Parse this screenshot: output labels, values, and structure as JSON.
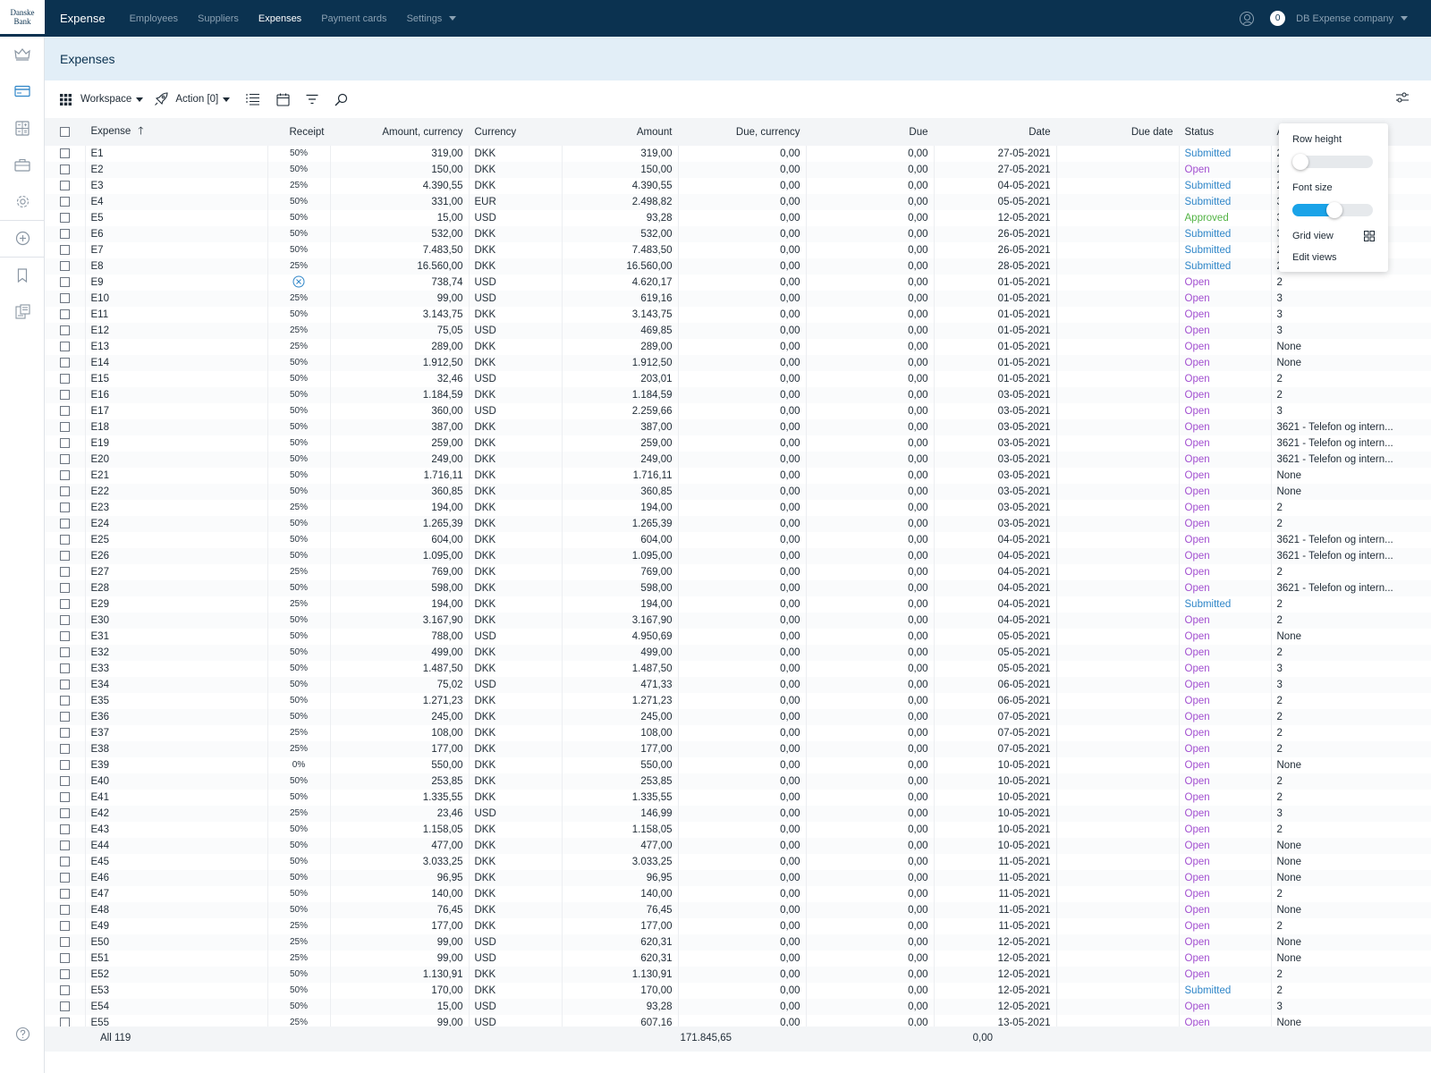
{
  "logo": {
    "line1": "Danske",
    "line2": "Bank"
  },
  "app_title": "Expense",
  "nav": [
    {
      "label": "Employees",
      "active": false
    },
    {
      "label": "Suppliers",
      "active": false
    },
    {
      "label": "Expenses",
      "active": true
    },
    {
      "label": "Payment cards",
      "active": false
    },
    {
      "label": "Settings",
      "active": false
    }
  ],
  "notifications": "0",
  "company": "DB Expense company",
  "page_title": "Expenses",
  "toolbar": {
    "workspace": "Workspace",
    "action": "Action [0]"
  },
  "columns": [
    "Expense",
    "Receipt",
    "Amount, currency",
    "Currency",
    "Amount",
    "Due, currency",
    "Due",
    "Date",
    "Due date",
    "Status",
    "Ac"
  ],
  "rows": [
    [
      "E1",
      "50%",
      "319,00",
      "DKK",
      "319,00",
      "0,00",
      "0,00",
      "27-05-2021",
      "",
      "Submitted",
      "2"
    ],
    [
      "E2",
      "50%",
      "150,00",
      "DKK",
      "150,00",
      "0,00",
      "0,00",
      "27-05-2021",
      "",
      "Open",
      "2"
    ],
    [
      "E3",
      "25%",
      "4.390,55",
      "DKK",
      "4.390,55",
      "0,00",
      "0,00",
      "04-05-2021",
      "",
      "Submitted",
      "2"
    ],
    [
      "E4",
      "50%",
      "331,00",
      "EUR",
      "2.498,82",
      "0,00",
      "0,00",
      "05-05-2021",
      "",
      "Submitted",
      "3"
    ],
    [
      "E5",
      "50%",
      "15,00",
      "USD",
      "93,28",
      "0,00",
      "0,00",
      "12-05-2021",
      "",
      "Approved",
      "3"
    ],
    [
      "E6",
      "50%",
      "532,00",
      "DKK",
      "532,00",
      "0,00",
      "0,00",
      "26-05-2021",
      "",
      "Submitted",
      "3"
    ],
    [
      "E7",
      "50%",
      "7.483,50",
      "DKK",
      "7.483,50",
      "0,00",
      "0,00",
      "26-05-2021",
      "",
      "Submitted",
      "2"
    ],
    [
      "E8",
      "25%",
      "16.560,00",
      "DKK",
      "16.560,00",
      "0,00",
      "0,00",
      "28-05-2021",
      "",
      "Submitted",
      "2"
    ],
    [
      "E9",
      "",
      "738,74",
      "USD",
      "4.620,17",
      "0,00",
      "0,00",
      "01-05-2021",
      "",
      "Open",
      "2"
    ],
    [
      "E10",
      "25%",
      "99,00",
      "USD",
      "619,16",
      "0,00",
      "0,00",
      "01-05-2021",
      "",
      "Open",
      "3"
    ],
    [
      "E11",
      "50%",
      "3.143,75",
      "DKK",
      "3.143,75",
      "0,00",
      "0,00",
      "01-05-2021",
      "",
      "Open",
      "3"
    ],
    [
      "E12",
      "25%",
      "75,05",
      "USD",
      "469,85",
      "0,00",
      "0,00",
      "01-05-2021",
      "",
      "Open",
      "3"
    ],
    [
      "E13",
      "25%",
      "289,00",
      "DKK",
      "289,00",
      "0,00",
      "0,00",
      "01-05-2021",
      "",
      "Open",
      "None"
    ],
    [
      "E14",
      "50%",
      "1.912,50",
      "DKK",
      "1.912,50",
      "0,00",
      "0,00",
      "01-05-2021",
      "",
      "Open",
      "None"
    ],
    [
      "E15",
      "50%",
      "32,46",
      "USD",
      "203,01",
      "0,00",
      "0,00",
      "01-05-2021",
      "",
      "Open",
      "2"
    ],
    [
      "E16",
      "50%",
      "1.184,59",
      "DKK",
      "1.184,59",
      "0,00",
      "0,00",
      "03-05-2021",
      "",
      "Open",
      "2"
    ],
    [
      "E17",
      "50%",
      "360,00",
      "USD",
      "2.259,66",
      "0,00",
      "0,00",
      "03-05-2021",
      "",
      "Open",
      "3"
    ],
    [
      "E18",
      "50%",
      "387,00",
      "DKK",
      "387,00",
      "0,00",
      "0,00",
      "03-05-2021",
      "",
      "Open",
      "3621 - Telefon og intern..."
    ],
    [
      "E19",
      "50%",
      "259,00",
      "DKK",
      "259,00",
      "0,00",
      "0,00",
      "03-05-2021",
      "",
      "Open",
      "3621 - Telefon og intern..."
    ],
    [
      "E20",
      "50%",
      "249,00",
      "DKK",
      "249,00",
      "0,00",
      "0,00",
      "03-05-2021",
      "",
      "Open",
      "3621 - Telefon og intern..."
    ],
    [
      "E21",
      "50%",
      "1.716,11",
      "DKK",
      "1.716,11",
      "0,00",
      "0,00",
      "03-05-2021",
      "",
      "Open",
      "None"
    ],
    [
      "E22",
      "50%",
      "360,85",
      "DKK",
      "360,85",
      "0,00",
      "0,00",
      "03-05-2021",
      "",
      "Open",
      "None"
    ],
    [
      "E23",
      "25%",
      "194,00",
      "DKK",
      "194,00",
      "0,00",
      "0,00",
      "03-05-2021",
      "",
      "Open",
      "2"
    ],
    [
      "E24",
      "50%",
      "1.265,39",
      "DKK",
      "1.265,39",
      "0,00",
      "0,00",
      "03-05-2021",
      "",
      "Open",
      "2"
    ],
    [
      "E25",
      "50%",
      "604,00",
      "DKK",
      "604,00",
      "0,00",
      "0,00",
      "04-05-2021",
      "",
      "Open",
      "3621 - Telefon og intern..."
    ],
    [
      "E26",
      "50%",
      "1.095,00",
      "DKK",
      "1.095,00",
      "0,00",
      "0,00",
      "04-05-2021",
      "",
      "Open",
      "3621 - Telefon og intern..."
    ],
    [
      "E27",
      "25%",
      "769,00",
      "DKK",
      "769,00",
      "0,00",
      "0,00",
      "04-05-2021",
      "",
      "Open",
      "2"
    ],
    [
      "E28",
      "50%",
      "598,00",
      "DKK",
      "598,00",
      "0,00",
      "0,00",
      "04-05-2021",
      "",
      "Open",
      "3621 - Telefon og intern..."
    ],
    [
      "E29",
      "25%",
      "194,00",
      "DKK",
      "194,00",
      "0,00",
      "0,00",
      "04-05-2021",
      "",
      "Submitted",
      "2"
    ],
    [
      "E30",
      "50%",
      "3.167,90",
      "DKK",
      "3.167,90",
      "0,00",
      "0,00",
      "04-05-2021",
      "",
      "Open",
      "2"
    ],
    [
      "E31",
      "50%",
      "788,00",
      "USD",
      "4.950,69",
      "0,00",
      "0,00",
      "05-05-2021",
      "",
      "Open",
      "None"
    ],
    [
      "E32",
      "50%",
      "499,00",
      "DKK",
      "499,00",
      "0,00",
      "0,00",
      "05-05-2021",
      "",
      "Open",
      "2"
    ],
    [
      "E33",
      "50%",
      "1.487,50",
      "DKK",
      "1.487,50",
      "0,00",
      "0,00",
      "05-05-2021",
      "",
      "Open",
      "3"
    ],
    [
      "E34",
      "50%",
      "75,02",
      "USD",
      "471,33",
      "0,00",
      "0,00",
      "06-05-2021",
      "",
      "Open",
      "3"
    ],
    [
      "E35",
      "50%",
      "1.271,23",
      "DKK",
      "1.271,23",
      "0,00",
      "0,00",
      "06-05-2021",
      "",
      "Open",
      "2"
    ],
    [
      "E36",
      "50%",
      "245,00",
      "DKK",
      "245,00",
      "0,00",
      "0,00",
      "07-05-2021",
      "",
      "Open",
      "2"
    ],
    [
      "E37",
      "25%",
      "108,00",
      "DKK",
      "108,00",
      "0,00",
      "0,00",
      "07-05-2021",
      "",
      "Open",
      "2"
    ],
    [
      "E38",
      "25%",
      "177,00",
      "DKK",
      "177,00",
      "0,00",
      "0,00",
      "07-05-2021",
      "",
      "Open",
      "2"
    ],
    [
      "E39",
      "0%",
      "550,00",
      "DKK",
      "550,00",
      "0,00",
      "0,00",
      "10-05-2021",
      "",
      "Open",
      "None"
    ],
    [
      "E40",
      "50%",
      "253,85",
      "DKK",
      "253,85",
      "0,00",
      "0,00",
      "10-05-2021",
      "",
      "Open",
      "2"
    ],
    [
      "E41",
      "50%",
      "1.335,55",
      "DKK",
      "1.335,55",
      "0,00",
      "0,00",
      "10-05-2021",
      "",
      "Open",
      "2"
    ],
    [
      "E42",
      "25%",
      "23,46",
      "USD",
      "146,99",
      "0,00",
      "0,00",
      "10-05-2021",
      "",
      "Open",
      "3"
    ],
    [
      "E43",
      "50%",
      "1.158,05",
      "DKK",
      "1.158,05",
      "0,00",
      "0,00",
      "10-05-2021",
      "",
      "Open",
      "2"
    ],
    [
      "E44",
      "50%",
      "477,00",
      "DKK",
      "477,00",
      "0,00",
      "0,00",
      "10-05-2021",
      "",
      "Open",
      "None"
    ],
    [
      "E45",
      "50%",
      "3.033,25",
      "DKK",
      "3.033,25",
      "0,00",
      "0,00",
      "11-05-2021",
      "",
      "Open",
      "None"
    ],
    [
      "E46",
      "50%",
      "96,95",
      "DKK",
      "96,95",
      "0,00",
      "0,00",
      "11-05-2021",
      "",
      "Open",
      "None"
    ],
    [
      "E47",
      "50%",
      "140,00",
      "DKK",
      "140,00",
      "0,00",
      "0,00",
      "11-05-2021",
      "",
      "Open",
      "2"
    ],
    [
      "E48",
      "50%",
      "76,45",
      "DKK",
      "76,45",
      "0,00",
      "0,00",
      "11-05-2021",
      "",
      "Open",
      "None"
    ],
    [
      "E49",
      "25%",
      "177,00",
      "DKK",
      "177,00",
      "0,00",
      "0,00",
      "11-05-2021",
      "",
      "Open",
      "2"
    ],
    [
      "E50",
      "25%",
      "99,00",
      "USD",
      "620,31",
      "0,00",
      "0,00",
      "12-05-2021",
      "",
      "Open",
      "None"
    ],
    [
      "E51",
      "25%",
      "99,00",
      "USD",
      "620,31",
      "0,00",
      "0,00",
      "12-05-2021",
      "",
      "Open",
      "None"
    ],
    [
      "E52",
      "50%",
      "1.130,91",
      "DKK",
      "1.130,91",
      "0,00",
      "0,00",
      "12-05-2021",
      "",
      "Open",
      "2"
    ],
    [
      "E53",
      "50%",
      "170,00",
      "DKK",
      "170,00",
      "0,00",
      "0,00",
      "12-05-2021",
      "",
      "Submitted",
      "2"
    ],
    [
      "E54",
      "50%",
      "15,00",
      "USD",
      "93,28",
      "0,00",
      "0,00",
      "12-05-2021",
      "",
      "Open",
      "3"
    ],
    [
      "E55",
      "25%",
      "99,00",
      "USD",
      "607,16",
      "0,00",
      "0,00",
      "13-05-2021",
      "",
      "Open",
      "None"
    ]
  ],
  "footer": {
    "count": "All 119",
    "amount_total": "171.845,65",
    "due_total": "0,00"
  },
  "popover": {
    "row_height_label": "Row height",
    "row_height_on": false,
    "font_size_label": "Font size",
    "font_size_on": true,
    "grid_view_label": "Grid view",
    "edit_views_label": "Edit views"
  },
  "colors": {
    "topbar": "#0b3250",
    "submitted": "#2f86c8",
    "open": "#a24fd0",
    "approved": "#51b343",
    "toggle_on": "#1aa3e8"
  },
  "icons": [
    "crown-icon",
    "card-icon",
    "calculator-icon",
    "briefcase-icon",
    "gear-icon",
    "plus-circle-icon",
    "bookmark-icon",
    "report-icon",
    "help-icon",
    "grid-icon",
    "rocket-icon",
    "list-icon",
    "calendar-icon",
    "filter-icon",
    "search-icon",
    "sliders-icon",
    "no-receipt-icon"
  ]
}
